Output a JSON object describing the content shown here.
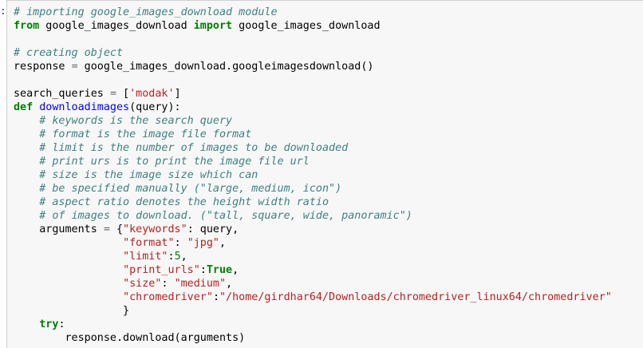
{
  "notebook": {
    "prompt": ":",
    "code_lines": [
      [
        {
          "t": "c",
          "v": "# importing google_images_download module"
        }
      ],
      [
        {
          "t": "k",
          "v": "from"
        },
        {
          "t": "n",
          "v": " google_images_download "
        },
        {
          "t": "k",
          "v": "import"
        },
        {
          "t": "n",
          "v": " google_images_download"
        }
      ],
      [],
      [
        {
          "t": "c",
          "v": "# creating object"
        }
      ],
      [
        {
          "t": "n",
          "v": "response "
        },
        {
          "t": "o",
          "v": "="
        },
        {
          "t": "n",
          "v": " google_images_download.googleimagesdownload()"
        }
      ],
      [],
      [
        {
          "t": "n",
          "v": "search_queries "
        },
        {
          "t": "o",
          "v": "="
        },
        {
          "t": "p",
          "v": " ["
        },
        {
          "t": "s",
          "v": "'modak'"
        },
        {
          "t": "p",
          "v": "]"
        }
      ],
      [
        {
          "t": "k",
          "v": "def"
        },
        {
          "t": "n",
          "v": " "
        },
        {
          "t": "f",
          "v": "downloadimages"
        },
        {
          "t": "p",
          "v": "(query):"
        }
      ],
      [
        {
          "t": "n",
          "v": "    "
        },
        {
          "t": "c",
          "v": "# keywords is the search query"
        }
      ],
      [
        {
          "t": "n",
          "v": "    "
        },
        {
          "t": "c",
          "v": "# format is the image file format"
        }
      ],
      [
        {
          "t": "n",
          "v": "    "
        },
        {
          "t": "c",
          "v": "# limit is the number of images to be downloaded"
        }
      ],
      [
        {
          "t": "n",
          "v": "    "
        },
        {
          "t": "c",
          "v": "# print urs is to print the image file url"
        }
      ],
      [
        {
          "t": "n",
          "v": "    "
        },
        {
          "t": "c",
          "v": "# size is the image size which can"
        }
      ],
      [
        {
          "t": "n",
          "v": "    "
        },
        {
          "t": "c",
          "v": "# be specified manually (\"large, medium, icon\")"
        }
      ],
      [
        {
          "t": "n",
          "v": "    "
        },
        {
          "t": "c",
          "v": "# aspect ratio denotes the height width ratio"
        }
      ],
      [
        {
          "t": "n",
          "v": "    "
        },
        {
          "t": "c",
          "v": "# of images to download. (\"tall, square, wide, panoramic\")"
        }
      ],
      [
        {
          "t": "n",
          "v": "    arguments "
        },
        {
          "t": "o",
          "v": "="
        },
        {
          "t": "p",
          "v": " {"
        },
        {
          "t": "s",
          "v": "\"keywords\""
        },
        {
          "t": "p",
          "v": ": query,"
        }
      ],
      [
        {
          "t": "n",
          "v": "                 "
        },
        {
          "t": "s",
          "v": "\"format\""
        },
        {
          "t": "p",
          "v": ": "
        },
        {
          "t": "s",
          "v": "\"jpg\""
        },
        {
          "t": "p",
          "v": ","
        }
      ],
      [
        {
          "t": "n",
          "v": "                 "
        },
        {
          "t": "s",
          "v": "\"limit\""
        },
        {
          "t": "p",
          "v": ":"
        },
        {
          "t": "num",
          "v": "5"
        },
        {
          "t": "p",
          "v": ","
        }
      ],
      [
        {
          "t": "n",
          "v": "                 "
        },
        {
          "t": "s",
          "v": "\"print_urls\""
        },
        {
          "t": "p",
          "v": ":"
        },
        {
          "t": "k",
          "v": "True"
        },
        {
          "t": "p",
          "v": ","
        }
      ],
      [
        {
          "t": "n",
          "v": "                 "
        },
        {
          "t": "s",
          "v": "\"size\""
        },
        {
          "t": "p",
          "v": ": "
        },
        {
          "t": "s",
          "v": "\"medium\""
        },
        {
          "t": "p",
          "v": ","
        }
      ],
      [
        {
          "t": "n",
          "v": "                 "
        },
        {
          "t": "s",
          "v": "\"chromedriver\""
        },
        {
          "t": "p",
          "v": ":"
        },
        {
          "t": "s",
          "v": "\"/home/girdhar64/Downloads/chromedriver_linux64/chromedriver\""
        }
      ],
      [
        {
          "t": "n",
          "v": "                 }"
        }
      ],
      [
        {
          "t": "n",
          "v": "    "
        },
        {
          "t": "k",
          "v": "try"
        },
        {
          "t": "p",
          "v": ":"
        }
      ],
      [
        {
          "t": "n",
          "v": "        response.download(arguments)"
        }
      ]
    ]
  }
}
